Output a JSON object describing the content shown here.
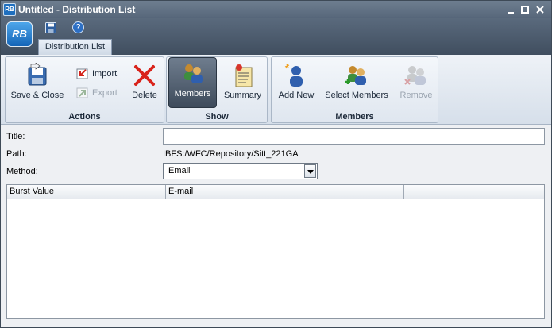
{
  "window": {
    "title": "Untitled - Distribution List",
    "logo_text": "RB",
    "controls": {
      "minimize": "✕",
      "maximize": "☐",
      "close": "✕"
    }
  },
  "quick_access": {
    "app_button_text": "RB",
    "help_text": "?",
    "tab": "Distribution List"
  },
  "ribbon": {
    "groups": {
      "actions": {
        "label": "Actions",
        "save_close": "Save & Close",
        "import": "Import",
        "export": "Export",
        "delete": "Delete"
      },
      "show": {
        "label": "Show",
        "members": "Members",
        "summary": "Summary"
      },
      "members": {
        "label": "Members",
        "add_new": "Add New",
        "select_members": "Select Members",
        "remove": "Remove"
      }
    }
  },
  "form": {
    "title_label": "Title:",
    "title_value": "",
    "path_label": "Path:",
    "path_value": "IBFS:/WFC/Repository/Sitt_221GA",
    "method_label": "Method:",
    "method_value": "Email",
    "grid": {
      "columns": [
        "Burst Value",
        "E-mail",
        ""
      ],
      "rows": []
    }
  },
  "colors": {
    "title_bar": "#5f6f82",
    "active_button": "#4a5767",
    "delete_red": "#d9231b"
  }
}
